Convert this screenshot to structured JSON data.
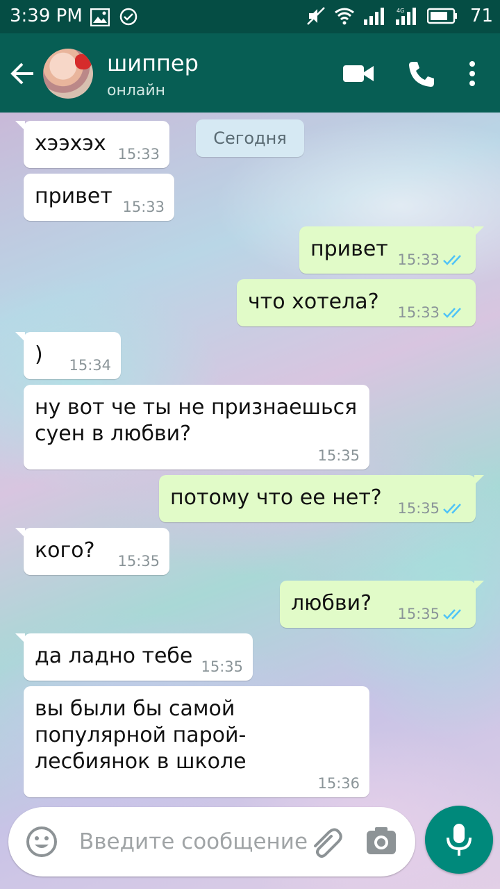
{
  "status_bar": {
    "time": "3:39 PM",
    "battery": "71",
    "icons": [
      "image-icon",
      "check-circle-icon",
      "mute-icon",
      "wifi-icon",
      "signal-icon",
      "signal-4g-icon",
      "battery-icon"
    ]
  },
  "header": {
    "contact_name": "шиппер",
    "contact_status": "онлайн"
  },
  "chat": {
    "date_divider": "Сегодня",
    "messages": [
      {
        "dir": "in",
        "text": "хээхэх",
        "time": "15:33"
      },
      {
        "dir": "in",
        "text": "привет",
        "time": "15:33"
      },
      {
        "dir": "out",
        "text": "привет",
        "time": "15:33",
        "read": true
      },
      {
        "dir": "out",
        "text": "что хотела?",
        "time": "15:33",
        "read": true
      },
      {
        "dir": "in",
        "text": ")",
        "time": "15:34"
      },
      {
        "dir": "in",
        "text": "ну вот че ты не признаешься\nсуен в любви?",
        "time": "15:35"
      },
      {
        "dir": "out",
        "text": "потому что ее нет?",
        "time": "15:35",
        "read": true
      },
      {
        "dir": "in",
        "text": "кого?",
        "time": "15:35"
      },
      {
        "dir": "out",
        "text": "любви?",
        "time": "15:35",
        "read": true
      },
      {
        "dir": "in",
        "text": "да ладно тебе",
        "time": "15:35"
      },
      {
        "dir": "in",
        "text": "вы были бы самой\nпопулярной парой-\nлесбиянок в школе",
        "time": "15:36"
      }
    ]
  },
  "composer": {
    "placeholder": "Введите сообщение"
  },
  "colors": {
    "header": "#075e54",
    "status_bar": "#054d44",
    "bubble_in": "#ffffff",
    "bubble_out": "#e1fbc8",
    "read_ticks": "#4fc3f7",
    "fab": "#00897b"
  }
}
